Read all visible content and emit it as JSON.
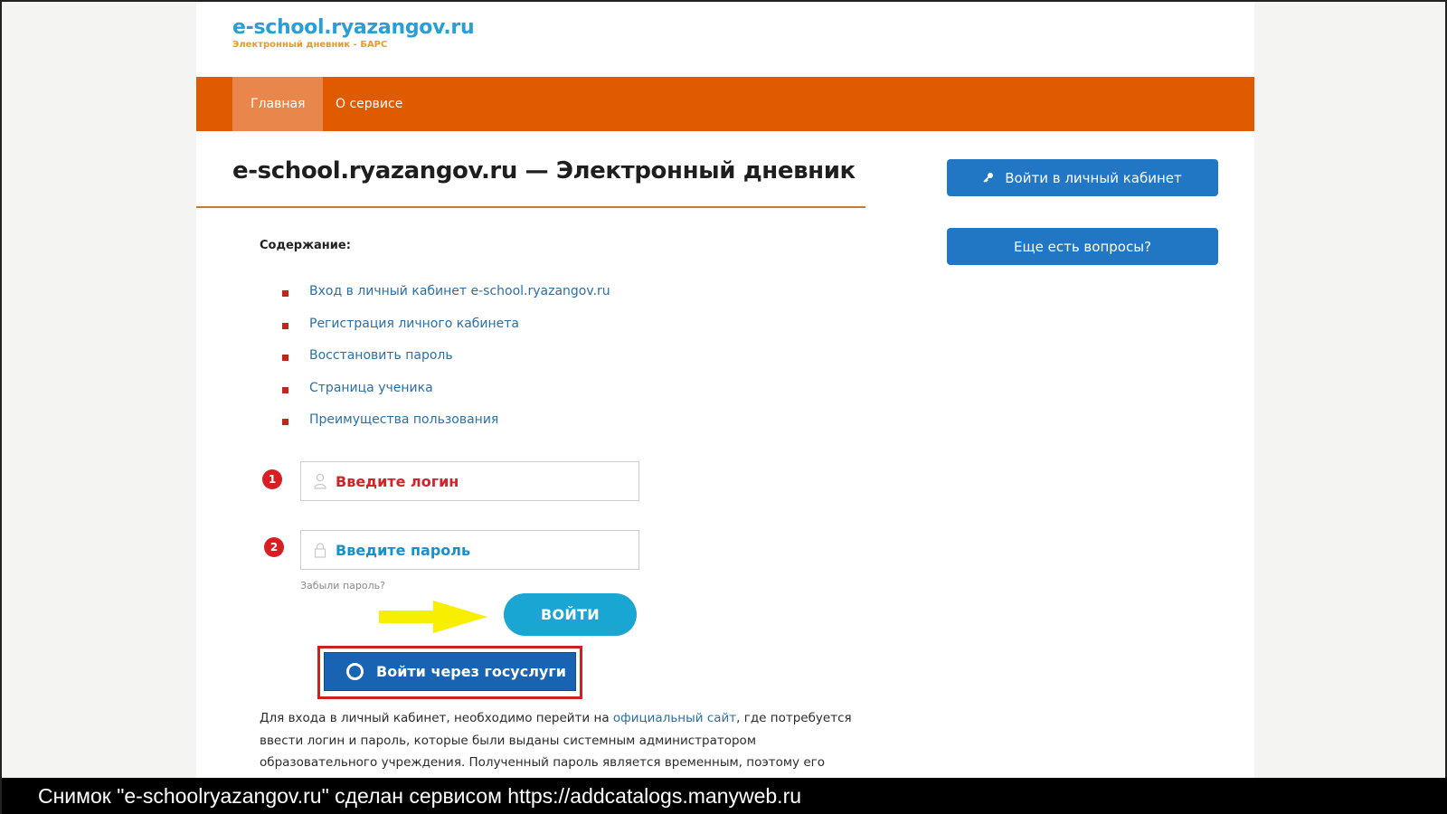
{
  "header": {
    "logo_title": "e-school.ryazangov.ru",
    "logo_subtitle": "Электронный дневник - БАРС"
  },
  "nav": {
    "items": [
      {
        "label": "Главная",
        "active": true
      },
      {
        "label": "О сервисе",
        "active": false
      }
    ]
  },
  "main": {
    "title": "e-school.ryazangov.ru — Электронный дневник",
    "toc_heading": "Содержание:",
    "toc": [
      "Вход в личный кабинет e-school.ryazangov.ru",
      "Регистрация личного кабинета",
      "Восстановить пароль",
      "Страница ученика",
      "Преимущества пользования"
    ]
  },
  "login_form": {
    "step1": "1",
    "step2": "2",
    "login_placeholder": "Введите логин",
    "password_placeholder": "Введите пароль",
    "forgot_label": "Забыли пароль?",
    "enter_label": "ВОЙТИ",
    "gosuslugi_label": "Войти через госуслуги"
  },
  "paragraph": {
    "part1": "Для входа в личный кабинет, необходимо перейти на ",
    "link": "официальный сайт",
    "part2": ", где потребуется ввести логин и пароль, которые были выданы системным администратором образовательного учреждения. Полученный пароль является временным, поэтому его можно сменить в личном"
  },
  "sidebar": {
    "login_button": "Войти в личный кабинет",
    "questions_button": "Еще есть вопросы?"
  },
  "caption": "Снимок \"e-schoolryazangov.ru\" сделан сервисом https://addcatalogs.manyweb.ru",
  "colors": {
    "nav_bg": "#e05a00",
    "accent_blue": "#2277c4",
    "enter_button": "#1aa6d3",
    "gosuslugi_button": "#1864b3",
    "highlight_red": "#d11d24",
    "arrow_yellow": "#f7ee00"
  }
}
